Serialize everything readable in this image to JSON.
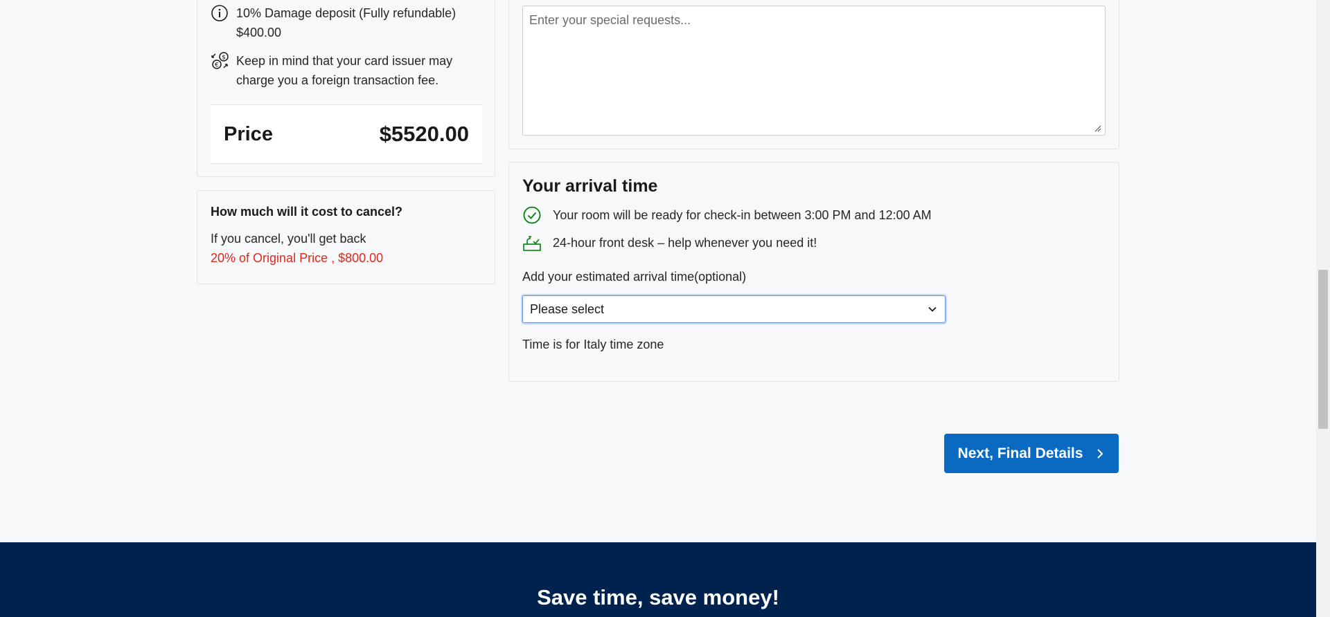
{
  "pricing": {
    "deposit_line1": "10% Damage deposit (Fully refundable)",
    "deposit_line2": "$400.00",
    "fee_line1": "Keep in mind that your card issuer may",
    "fee_line2": "charge you a foreign transaction fee.",
    "price_label": "Price",
    "price_value": "$5520.00"
  },
  "cancellation": {
    "title": "How much will it cost to cancel?",
    "text": "If you cancel, you'll get back",
    "refund": "20% of Original Price , $800.00"
  },
  "special_requests": {
    "placeholder": "Enter your special requests..."
  },
  "arrival": {
    "title": "Your arrival time",
    "checkin_text": "Your room will be ready for check-in between 3:00 PM and 12:00 AM",
    "front_desk_text": "24-hour front desk – help whenever you need it!",
    "select_label": "Add your estimated arrival time(optional)",
    "select_value": "Please select",
    "timezone_note": "Time is for Italy time zone"
  },
  "actions": {
    "next_label": "Next, Final Details"
  },
  "footer": {
    "title": "Save time, save money!"
  },
  "colors": {
    "primary_button": "#0a6ac2",
    "footer_bg": "#00224f",
    "refund_red": "#e0271a",
    "success_green": "#008009"
  },
  "icons": {
    "deposit": "info-circle-icon",
    "fee": "currency-exchange-icon",
    "checkin": "check-circle-icon",
    "front_desk": "front-desk-bell-icon",
    "select": "chevron-down-icon",
    "next": "chevron-right-icon"
  }
}
